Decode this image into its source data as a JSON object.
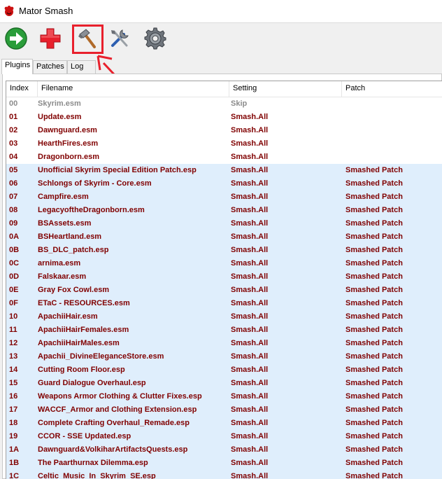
{
  "window": {
    "title": "Mator Smash"
  },
  "toolbar": {
    "buttons": [
      {
        "name": "go-icon"
      },
      {
        "name": "add-icon"
      },
      {
        "name": "hammer-icon"
      },
      {
        "name": "tools-icon"
      },
      {
        "name": "gear-icon"
      }
    ],
    "accent_green": "#2a9d3a",
    "accent_red": "#e8202c",
    "highlight_color": "#e8202c"
  },
  "tabs": [
    {
      "label": "Plugins",
      "active": true
    },
    {
      "label": "Patches",
      "active": false
    },
    {
      "label": "Log",
      "active": false
    }
  ],
  "columns": {
    "index": "Index",
    "filename": "Filename",
    "setting": "Setting",
    "patch": "Patch"
  },
  "rows": [
    {
      "index": "00",
      "filename": "Skyrim.esm",
      "setting": "Skip",
      "patch": ""
    },
    {
      "index": "01",
      "filename": "Update.esm",
      "setting": "Smash.All",
      "patch": ""
    },
    {
      "index": "02",
      "filename": "Dawnguard.esm",
      "setting": "Smash.All",
      "patch": ""
    },
    {
      "index": "03",
      "filename": "HearthFires.esm",
      "setting": "Smash.All",
      "patch": ""
    },
    {
      "index": "04",
      "filename": "Dragonborn.esm",
      "setting": "Smash.All",
      "patch": ""
    },
    {
      "index": "05",
      "filename": "Unofficial Skyrim Special Edition Patch.esp",
      "setting": "Smash.All",
      "patch": "Smashed Patch"
    },
    {
      "index": "06",
      "filename": "Schlongs of Skyrim - Core.esm",
      "setting": "Smash.All",
      "patch": "Smashed Patch"
    },
    {
      "index": "07",
      "filename": "Campfire.esm",
      "setting": "Smash.All",
      "patch": "Smashed Patch"
    },
    {
      "index": "08",
      "filename": "LegacyoftheDragonborn.esm",
      "setting": "Smash.All",
      "patch": "Smashed Patch"
    },
    {
      "index": "09",
      "filename": "BSAssets.esm",
      "setting": "Smash.All",
      "patch": "Smashed Patch"
    },
    {
      "index": "0A",
      "filename": "BSHeartland.esm",
      "setting": "Smash.All",
      "patch": "Smashed Patch"
    },
    {
      "index": "0B",
      "filename": "BS_DLC_patch.esp",
      "setting": "Smash.All",
      "patch": "Smashed Patch"
    },
    {
      "index": "0C",
      "filename": "arnima.esm",
      "setting": "Smash.All",
      "patch": "Smashed Patch"
    },
    {
      "index": "0D",
      "filename": "Falskaar.esm",
      "setting": "Smash.All",
      "patch": "Smashed Patch"
    },
    {
      "index": "0E",
      "filename": "Gray Fox Cowl.esm",
      "setting": "Smash.All",
      "patch": "Smashed Patch"
    },
    {
      "index": "0F",
      "filename": "ETaC - RESOURCES.esm",
      "setting": "Smash.All",
      "patch": "Smashed Patch"
    },
    {
      "index": "10",
      "filename": "ApachiiHair.esm",
      "setting": "Smash.All",
      "patch": "Smashed Patch"
    },
    {
      "index": "11",
      "filename": "ApachiiHairFemales.esm",
      "setting": "Smash.All",
      "patch": "Smashed Patch"
    },
    {
      "index": "12",
      "filename": "ApachiiHairMales.esm",
      "setting": "Smash.All",
      "patch": "Smashed Patch"
    },
    {
      "index": "13",
      "filename": "Apachii_DivineEleganceStore.esm",
      "setting": "Smash.All",
      "patch": "Smashed Patch"
    },
    {
      "index": "14",
      "filename": "Cutting Room Floor.esp",
      "setting": "Smash.All",
      "patch": "Smashed Patch"
    },
    {
      "index": "15",
      "filename": "Guard Dialogue Overhaul.esp",
      "setting": "Smash.All",
      "patch": "Smashed Patch"
    },
    {
      "index": "16",
      "filename": "Weapons Armor Clothing & Clutter Fixes.esp",
      "setting": "Smash.All",
      "patch": "Smashed Patch"
    },
    {
      "index": "17",
      "filename": "WACCF_Armor and Clothing Extension.esp",
      "setting": "Smash.All",
      "patch": "Smashed Patch"
    },
    {
      "index": "18",
      "filename": "Complete Crafting Overhaul_Remade.esp",
      "setting": "Smash.All",
      "patch": "Smashed Patch"
    },
    {
      "index": "19",
      "filename": "CCOR - SSE Updated.esp",
      "setting": "Smash.All",
      "patch": "Smashed Patch"
    },
    {
      "index": "1A",
      "filename": "Dawnguard&VolkiharArtifactsQuests.esp",
      "setting": "Smash.All",
      "patch": "Smashed Patch"
    },
    {
      "index": "1B",
      "filename": "The Paarthurnax Dilemma.esp",
      "setting": "Smash.All",
      "patch": "Smashed Patch"
    },
    {
      "index": "1C",
      "filename": "Celtic_Music_In_Skyrim_SE.esp",
      "setting": "Smash.All",
      "patch": "Smashed Patch"
    }
  ]
}
